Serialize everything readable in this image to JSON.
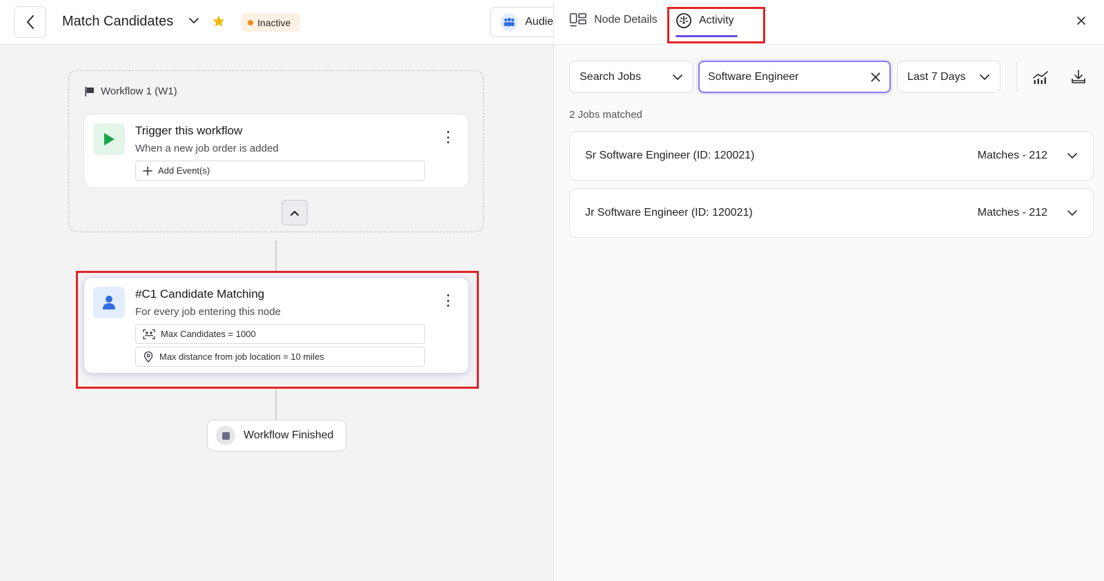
{
  "header": {
    "title": "Match Candidates",
    "status": "Inactive",
    "audience_label": "Audie"
  },
  "workflow": {
    "group_label": "Workflow 1 (W1)",
    "trigger": {
      "title": "Trigger this workflow",
      "subtitle": "When a new job order is added",
      "add_event_label": "Add Event(s)"
    },
    "matching_node": {
      "title": "#C1 Candidate Matching",
      "subtitle": "For every job entering this node",
      "max_candidates": "Max Candidates = 1000",
      "max_distance": "Max distance from job location = 10 miles"
    },
    "finish_label": "Workflow Finished"
  },
  "panel": {
    "tabs": [
      {
        "label": "Node Details"
      },
      {
        "label": "Activity"
      }
    ],
    "job_filter": "Search Jobs",
    "search_value": "Software Engineer",
    "date_range": "Last 7 Days",
    "matched_count": "2 Jobs matched",
    "jobs": [
      {
        "title": "Sr Software Engineer (ID: 120021)",
        "matches": "Matches - 212"
      },
      {
        "title": "Jr Software Engineer (ID: 120021)",
        "matches": "Matches - 212"
      }
    ]
  },
  "colors": {
    "accent": "#6b4ce6",
    "status_dot": "#f08b1d",
    "highlight": "#e32222",
    "trigger_icon": "#1aa34a",
    "person_icon": "#2f6fe0"
  }
}
